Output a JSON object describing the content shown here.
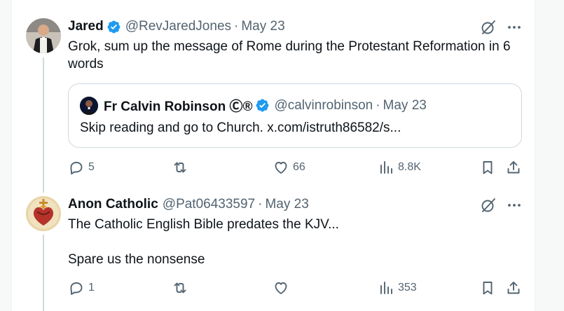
{
  "tweets": [
    {
      "name": "Jared",
      "handle": "@RevJaredJones",
      "date": "May 23",
      "text": "Grok, sum up the message of Rome during the Protestant Reformation in 6 words",
      "quote": {
        "name": "Fr Calvin Robinson Ⓒ®",
        "handle": "@calvinrobinson",
        "date": "May 23",
        "text": "Skip reading and go to Church. x.com/istruth86582/s..."
      },
      "replies": "5",
      "retweets": "",
      "likes": "66",
      "views": "8.8K"
    },
    {
      "name": "Anon Catholic",
      "handle": "@Pat06433597",
      "date": "May 23",
      "text": "The Catholic English Bible predates the KJV...\n\nSpare us the nonsense",
      "replies": "1",
      "retweets": "",
      "likes": "",
      "views": "353"
    }
  ],
  "separator": "·",
  "colors": {
    "verified": "#1d9bf0",
    "muted": "#536471",
    "text": "#0f1419",
    "border": "#cfd9de"
  },
  "icons": [
    "grok-icon",
    "more-icon",
    "reply-icon",
    "retweet-icon",
    "like-icon",
    "views-icon",
    "bookmark-icon",
    "share-icon",
    "verified-badge-icon"
  ]
}
